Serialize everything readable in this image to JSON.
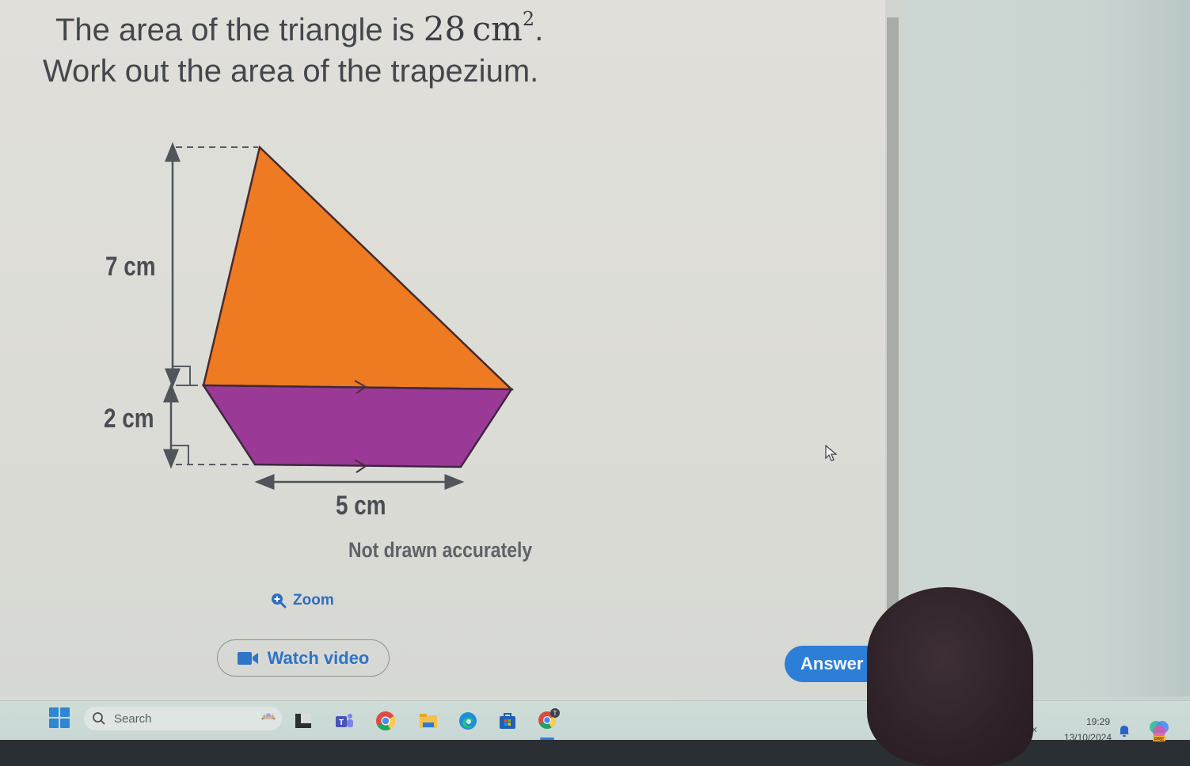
{
  "question": {
    "line1_prefix": "The area of the triangle is ",
    "line1_value": "28",
    "line1_unit": "cm",
    "line1_exponent": "2",
    "line1_suffix": ".",
    "line2": "Work out the area of the trapezium."
  },
  "figure": {
    "triangle_color": "#ee7a22",
    "trapezium_color": "#9b3a96",
    "labels": {
      "triangle_height": "7 cm",
      "trapezium_height": "2 cm",
      "trapezium_bottom": "5 cm"
    },
    "note": "Not drawn accurately"
  },
  "actions": {
    "zoom_label": "Zoom",
    "watch_video_label": "Watch video",
    "answer_label": "Answer"
  },
  "colors": {
    "accent_blue": "#2d7ed6",
    "link_blue": "#2e6fbf"
  },
  "taskbar": {
    "search_placeholder": "Search",
    "apps": [
      "widgets-icon",
      "terminal-icon",
      "teams-icon",
      "chrome-icon",
      "file-explorer-icon",
      "edge-icon",
      "microsoft-store-icon",
      "chrome-profile-icon"
    ],
    "tray": {
      "time": "19:29",
      "date": "13/10/2024",
      "copilot_badge": "PRE"
    }
  }
}
